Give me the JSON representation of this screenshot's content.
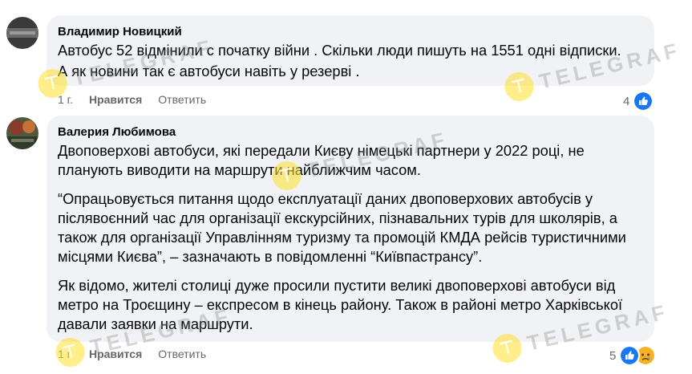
{
  "comments": [
    {
      "author": "Владимир Новицкий",
      "paragraphs": [
        "Автобус 52 відмінили с початку війни . Скільки люди пишуть на 1551 одні відписки.",
        "А як новини так є автобуси навіть у резерві ."
      ],
      "time": "1 г.",
      "like_label": "Нравится",
      "reply_label": "Ответить",
      "reaction_count": "4",
      "reaction_icons": [
        "like-icon"
      ]
    },
    {
      "author": "Валерия Любимова",
      "paragraphs": [
        "Двоповерхові автобуси, які передали Києву німецькі партнери у 2022 році, не планують виводити на маршрути найближчим часом.",
        "“Опрацьовується питання щодо експлуатації даних двоповерхових автобусів у післявоєнний час для організації екскурсійних, пізнавальних турів для школярів, а також для організації Управлінням туризму та промоцій КМДА рейсів туристичними місцями Києва”, – зазначають в повідомленні “Київпастрансу”.",
        "Як відомо, жителі столиці дуже просили пустити великі двоповерхові автобуси від метро на Троєщину – експресом в кінець району. Також в районі метро Харківської давали заявки на маршрути."
      ],
      "time": "1 г.",
      "like_label": "Нравится",
      "reply_label": "Ответить",
      "reaction_count": "5",
      "reaction_icons": [
        "like-icon",
        "sad-icon"
      ]
    }
  ],
  "watermark": "TELEGRAF",
  "colors": {
    "bubble": "#f0f2f5",
    "meta": "#65676b",
    "like_blue": "#1877f2",
    "sad_yellow": "#f7b125"
  }
}
